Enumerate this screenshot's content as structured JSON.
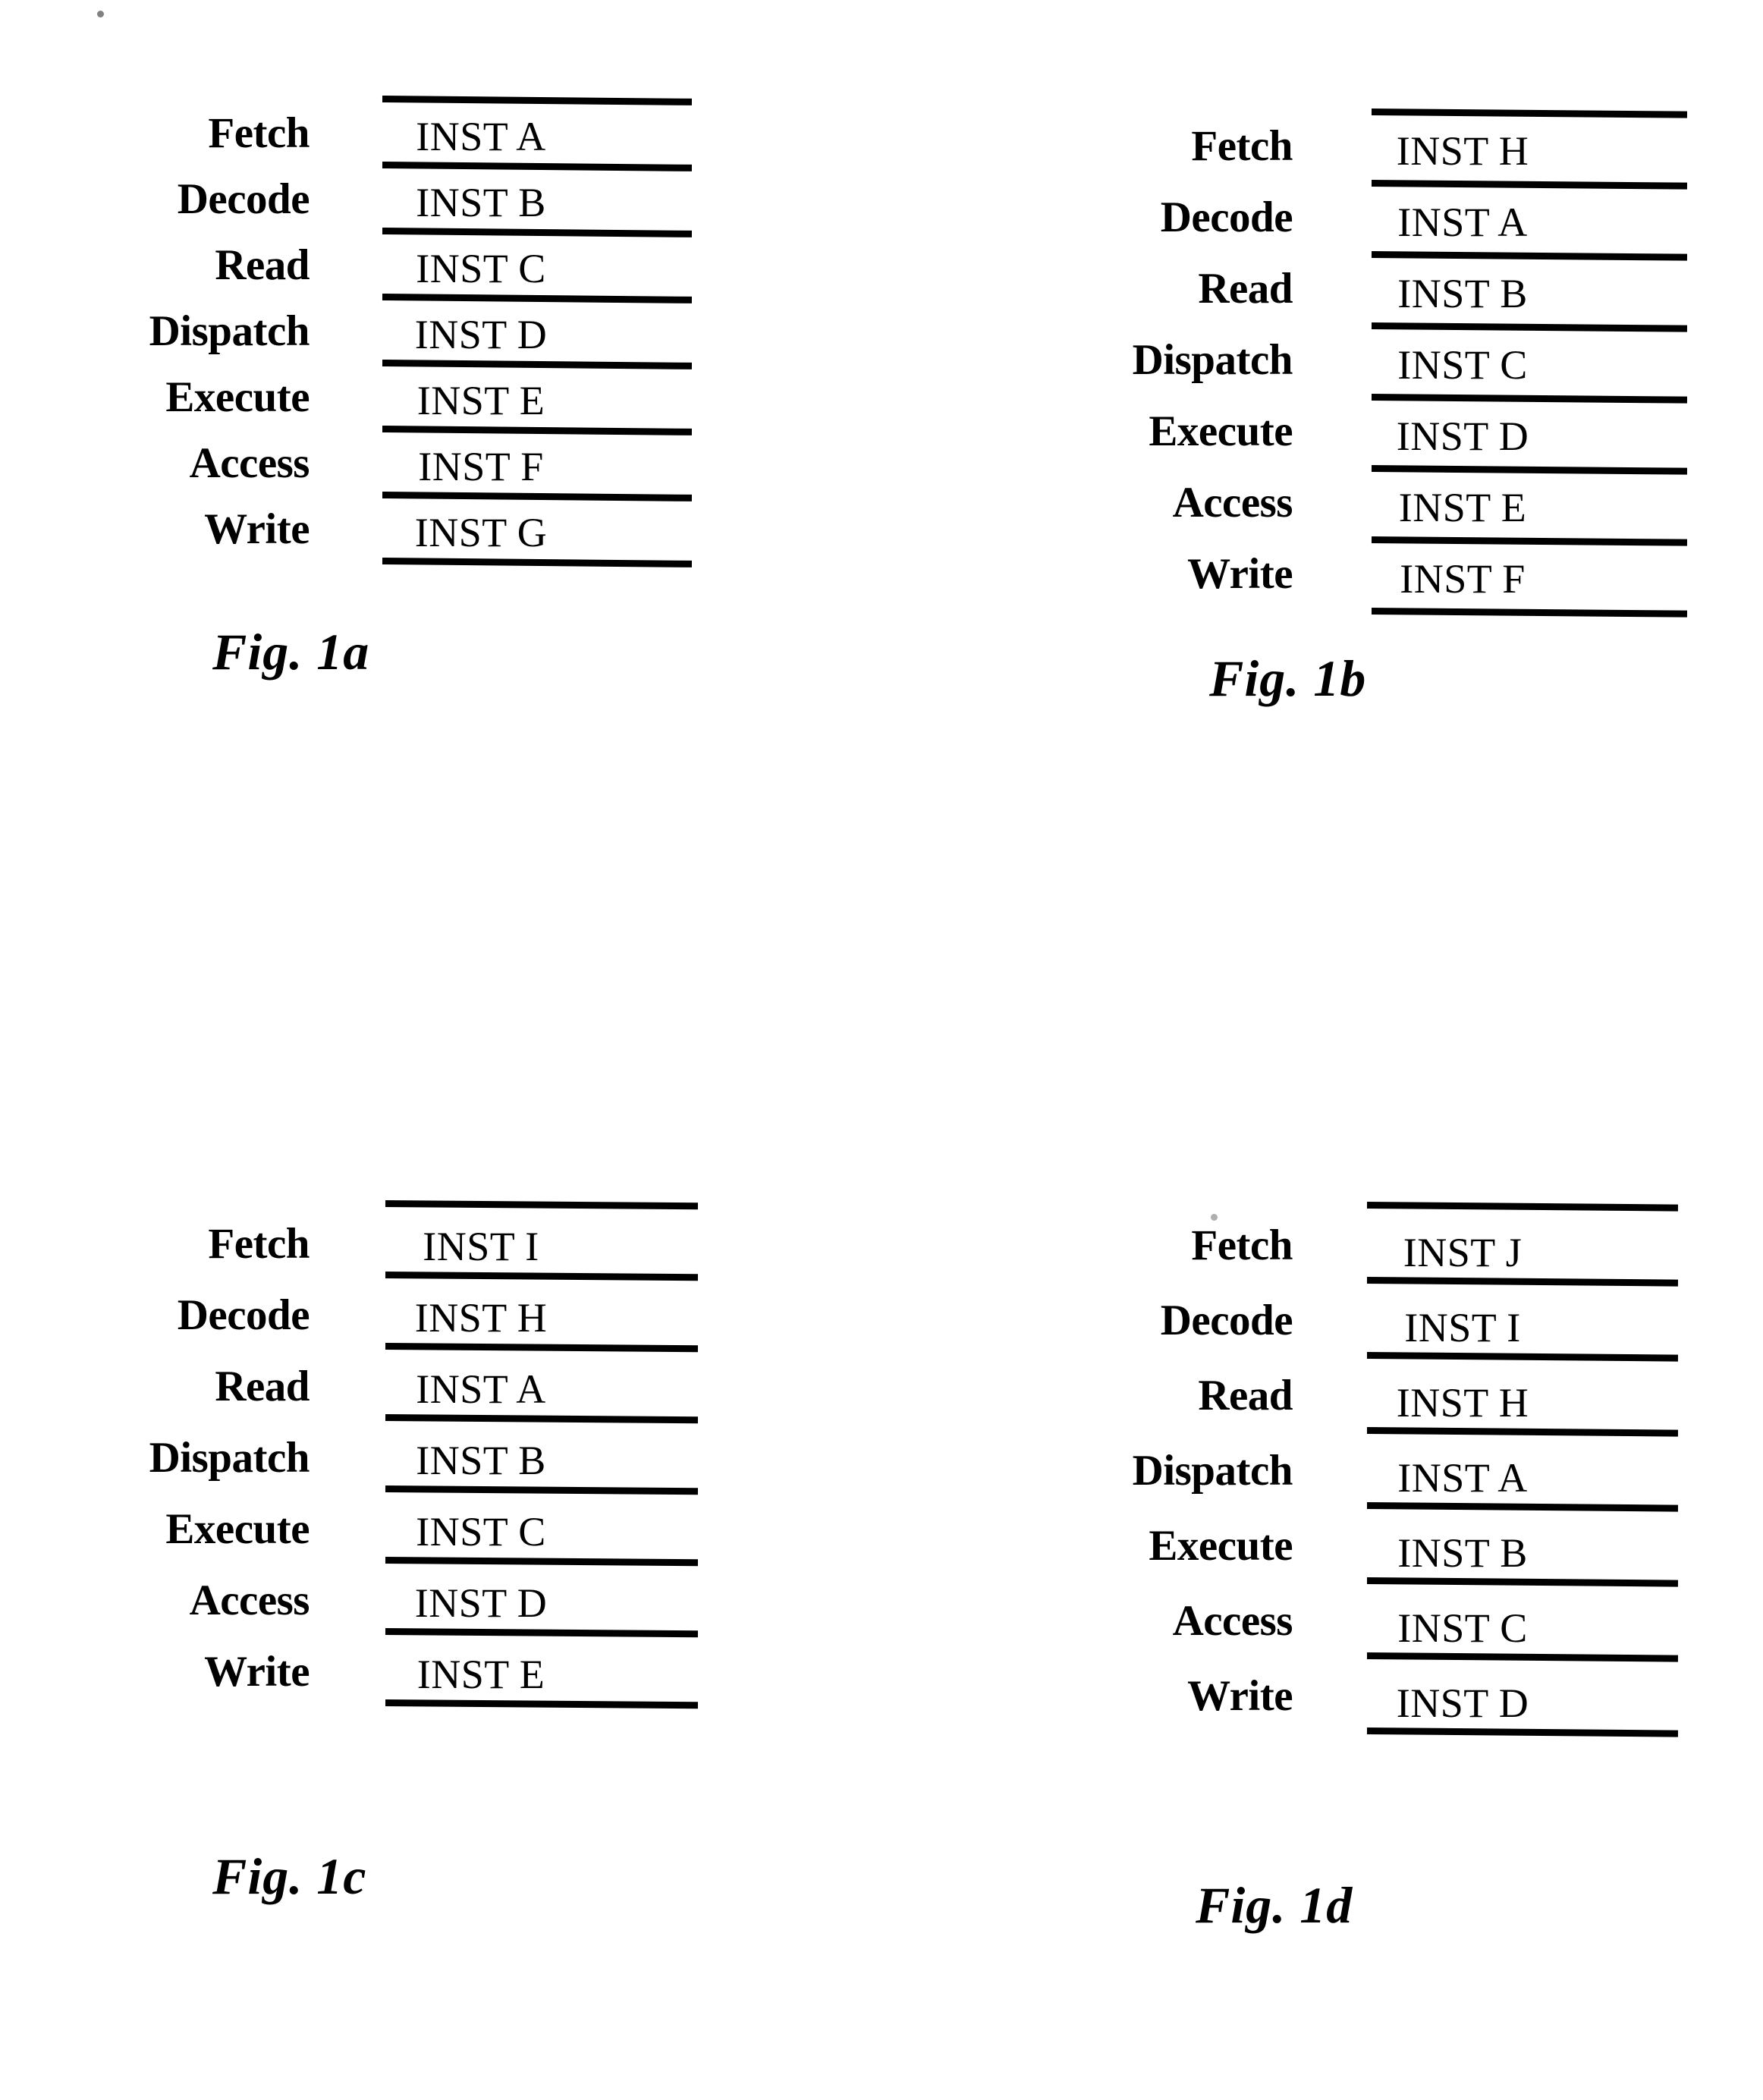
{
  "document": {
    "type": "patent-drawing-sheet",
    "background_color": "#ffffff",
    "ink_color": "#000000"
  },
  "stages": [
    "Fetch",
    "Decode",
    "Read",
    "Dispatch",
    "Execute",
    "Access",
    "Write"
  ],
  "figures": [
    {
      "id": "fig-1a",
      "caption": "Fig. 1a",
      "position": "top-left",
      "rows": [
        {
          "stage": "Fetch",
          "instruction": "INST A"
        },
        {
          "stage": "Decode",
          "instruction": "INST B"
        },
        {
          "stage": "Read",
          "instruction": "INST C"
        },
        {
          "stage": "Dispatch",
          "instruction": "INST D"
        },
        {
          "stage": "Execute",
          "instruction": "INST E"
        },
        {
          "stage": "Access",
          "instruction": "INST F"
        },
        {
          "stage": "Write",
          "instruction": "INST G"
        }
      ]
    },
    {
      "id": "fig-1b",
      "caption": "Fig. 1b",
      "position": "top-right",
      "rows": [
        {
          "stage": "Fetch",
          "instruction": "INST H"
        },
        {
          "stage": "Decode",
          "instruction": "INST A"
        },
        {
          "stage": "Read",
          "instruction": "INST B"
        },
        {
          "stage": "Dispatch",
          "instruction": "INST C"
        },
        {
          "stage": "Execute",
          "instruction": "INST D"
        },
        {
          "stage": "Access",
          "instruction": "INST E"
        },
        {
          "stage": "Write",
          "instruction": "INST F"
        }
      ]
    },
    {
      "id": "fig-1c",
      "caption": "Fig. 1c",
      "position": "bottom-left",
      "rows": [
        {
          "stage": "Fetch",
          "instruction": "INST I"
        },
        {
          "stage": "Decode",
          "instruction": "INST H"
        },
        {
          "stage": "Read",
          "instruction": "INST A"
        },
        {
          "stage": "Dispatch",
          "instruction": "INST B"
        },
        {
          "stage": "Execute",
          "instruction": "INST C"
        },
        {
          "stage": "Access",
          "instruction": "INST D"
        },
        {
          "stage": "Write",
          "instruction": "INST E"
        }
      ]
    },
    {
      "id": "fig-1d",
      "caption": "Fig. 1d",
      "position": "bottom-right",
      "rows": [
        {
          "stage": "Fetch",
          "instruction": "INST J"
        },
        {
          "stage": "Decode",
          "instruction": "INST I"
        },
        {
          "stage": "Read",
          "instruction": "INST H"
        },
        {
          "stage": "Dispatch",
          "instruction": "INST A"
        },
        {
          "stage": "Execute",
          "instruction": "INST B"
        },
        {
          "stage": "Access",
          "instruction": "INST C"
        },
        {
          "stage": "Write",
          "instruction": "INST D"
        }
      ]
    }
  ]
}
